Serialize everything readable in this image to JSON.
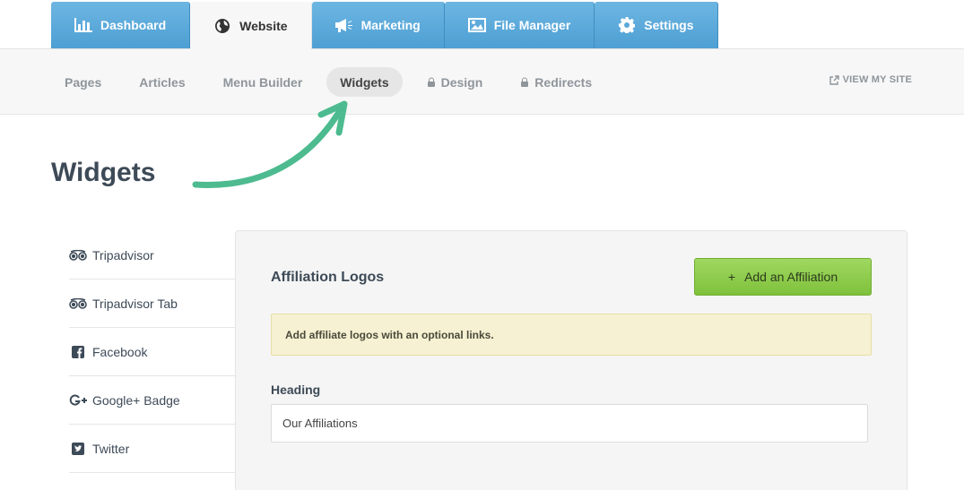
{
  "top_tabs": [
    {
      "label": "Dashboard",
      "icon": "bar-chart-icon"
    },
    {
      "label": "Website",
      "icon": "globe-icon",
      "active": true
    },
    {
      "label": "Marketing",
      "icon": "megaphone-icon"
    },
    {
      "label": "File Manager",
      "icon": "image-icon"
    },
    {
      "label": "Settings",
      "icon": "gear-icon"
    }
  ],
  "subnav": {
    "items": [
      {
        "label": "Pages"
      },
      {
        "label": "Articles"
      },
      {
        "label": "Menu Builder"
      },
      {
        "label": "Widgets",
        "active": true
      },
      {
        "label": "Design",
        "locked": true
      },
      {
        "label": "Redirects",
        "locked": true
      }
    ],
    "view_site": "VIEW MY SITE"
  },
  "page_title": "Widgets",
  "sidebar": {
    "items": [
      {
        "label": "Tripadvisor",
        "icon": "tripadvisor-icon"
      },
      {
        "label": "Tripadvisor Tab",
        "icon": "tripadvisor-icon"
      },
      {
        "label": "Facebook",
        "icon": "facebook-icon"
      },
      {
        "label": "Google+ Badge",
        "icon": "google-plus-icon"
      },
      {
        "label": "Twitter",
        "icon": "twitter-icon"
      }
    ]
  },
  "panel": {
    "title": "Affiliation Logos",
    "add_button": "Add an Affiliation",
    "add_plus": "+",
    "notice": "Add affiliate logos with an optional links.",
    "heading_label": "Heading",
    "heading_value": "Our Affiliations"
  },
  "colors": {
    "tab_blue": "#5aa9da",
    "accent_green": "#8ccd4a",
    "arrow_green": "#4dbb8f",
    "notice_bg": "#f6f1d2"
  }
}
